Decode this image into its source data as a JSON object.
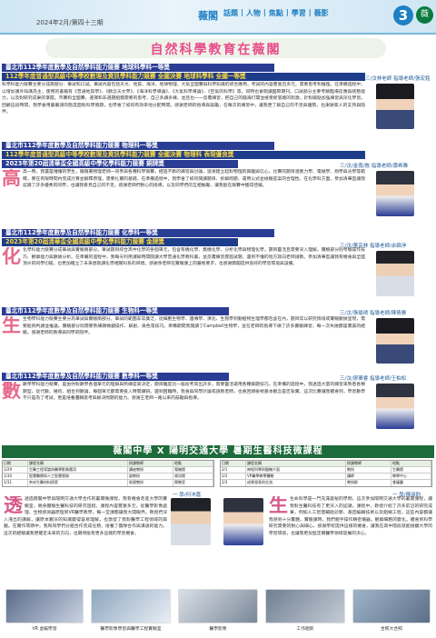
{
  "header": {
    "date": "2024年2月/第四十三期",
    "nav_title": "薇閣",
    "nav": [
      "話題",
      "人物",
      "焦點",
      "學習",
      "薇影"
    ],
    "page_number": "3",
    "logo": "薇"
  },
  "title": "自然科學教育在薇閣",
  "sections": [
    {
      "headline1": "臺北市112學年度數學及自然學科能力競賽 地球科學科一等獎",
      "headline2": "112學年度普通型高級中等學校數理及資訊學科能力競賽 全國決賽 地球科學科 全國一等獎",
      "caption": "三/汶林老師 指導老師/張宏銘",
      "text": "科學科能力競賽主要分成兩部分：筆試和口試。筆試內容包括天文、地質、海洋、地球物理、大氣全國賽與科學知識的綜合應用，考試的內容豐富且多元，需要思考和推理。在準備過程中，以增加課外知識為主，使用的書籍有《普通地質學》、《觀念天文學》、《海洋科學導論》、《大氣科學導論》、《空氣的科學》等，同時也會閱讀國際期刊。口試部分主要考驗臨場反應與統整能力，以及對研究成果的掌握。市賽和全國賽，選擇和非選題組都需要的思考，自己多讀多練，並且也一一反覆練習，把自己的腦海打開並接受新思路的刺激，針對弱點加強練習與深化學習。回顧這段時間，我學會用最嚴謹的態度面對科學問題，也學會了如何有效率地分配時間。感謝老師的指導與鼓勵，在每次的練習中，讓我更了解自己的不足與優勢，也謝謝家人的支持與陪伴。"
    },
    {
      "headline1": "臺北市112學年度數學及自然學科能力競賽 物理科一等獎",
      "headline2": "112學年度普通型高級中等學校數理及資訊學科能力競賽 全國決賽 物理科 表現優良獎",
      "headline3": "2023年第20屆清華盃全國高級中學化學科能力競賽 銅牌獎",
      "caption": "三/汶/金寬/敘 指導老師/蕭希雅",
      "text": "高一時，我還是懵懂的學生，跟隨著物理老師一同參與各種科學競賽。經過不斷的練習與討論，逐漸建立起對物理的興趣與信心。比賽的題目涵蓋力學、電磁學、熱學與光學等範疇，要在有限時間內完成計算並解釋原理，需要扎實的基礎。在準備過程中，我學會了如何閱讀題目、拆解問題、運用公式並檢驗答案的合理性。在化學科方面，參加清華盃讓我認識了許多優秀的同學，也讓我看見自己的不足。感謝老師們耐心的指導，以及同學們的互相勉勵，讓我能在競賽中獲得佳績。"
    },
    {
      "headline1": "臺北市112學年度數學及自然學科能力競賽 化學科一等獎",
      "headline2": "2023年第20屆清華盃全國高級中學化學科能力競賽 金牌獎",
      "caption": "三/汶/董芸林 指導老師/余錦淨",
      "text": "化學科能力競賽分成筆試與實驗兩部分。筆試題目綜合高中化學的各個單元，包含有機化學、無機化學、分析化學與物理化學，題目靈活且需要深入理解。實驗部分則考驗操作技巧、觀察能力與數據分析。在準備的過程中，我每天利用課餘時間閱讀大學普通化學教科書，並反覆練習歷屆試題，遇到不懂的地方就向老師請教。參加清華盃讓我有機會與全國頂尖的同學切磋，也更加確立了未來想就讀化學相關科系的目標。感謝余老師在實驗課上的嚴格要求，也感謝薇閣提供良好的學習環境與設備。"
    },
    {
      "headline1": "臺北市112學年度數學及自然學科能力競賽 生物科一等獎",
      "caption": "三/汶/張瑜琇 指導老師/陳倩雅",
      "text": "生物學科能力競賽主要分為筆試與實驗兩部分。筆試的範圍非常廣泛，從細胞生物學、遺傳學、演化、生態學到動植物生理學都包含在內，題目常以研究情境或實驗數據呈現，需要能夠判讀並推論。實驗部分則需要熟練顯微鏡操作、解剖、染色等技巧。準備期間我閱讀了Campbell生物學，並在老師的指導下做了許多實驗練習，每一次失敗都是寶貴的經驗。感謝老師的教導與同學的陪伴。"
    },
    {
      "headline1": "臺北市112學年度數學及自然學科能力競賽 數學科一等獎",
      "caption": "三/汶/廖軍睿 指導老師/王柏松",
      "text": "數學學科能力競賽，是由你對數學各個單元的理解與熟練度來決定，題目難度比一般段考高出許多，需要靈活運用各種解題技巧。在準備的過程中，我透過大量的練習來熟悉各類題型，從代數、幾何、組合到數論，每個單元都需要投入時間鑽研。遇到困難時，我會與同學討論或請教老師，也會回頭檢視基本觀念是否紮實。這次比賽讓我體會到，學習數學不只是為了考試，更是培養邏輯思考與解決問題的能力。感謝王老師一路以來的鼓勵與指導。"
    }
  ],
  "banner": "薇閣中學 X 陽明交通大學 暑期生醫科技微課程",
  "table_left": [
    [
      "日期",
      "課程名稱",
      "授課教師",
      "地點"
    ],
    [
      "1/29",
      "生醫工程導論與醫學影像應用",
      "講座教授",
      "電機館"
    ],
    [
      "1/30",
      "智慧醫療與人工智慧實務",
      "副教授",
      "資訊館"
    ],
    [
      "1/31",
      "奈米生醫材料探索",
      "助理教授",
      "實驗室"
    ]
  ],
  "table_right": [
    [
      "日期",
      "課程名稱",
      "授課教師",
      "地點"
    ],
    [
      "2/1",
      "神經科學與腦機介面",
      "教授",
      "生醫館"
    ],
    [
      "2/2",
      "VR醫學教學體驗",
      "講師",
      "教學中心"
    ],
    [
      "2/3",
      "成果發表與交流",
      "教授群",
      "會議廳"
    ]
  ],
  "bottom_left": {
    "caption": "一 學/何沛嘉",
    "text": "透過薇閣中學與陽明交通大學合作的暑期微課程，我有機會走進大學的實驗室，親身體驗生醫科技的研究過程。課程內容豐富多元，從醫學影像處理、生物感測器原理到VR醫學教學，每一堂課都讓我大開眼界。教授們深入淺出的講解，讓原本艱深的知識變得容易理解，也激發了我對醫學工程領域的興趣。在實作環節中，我和同學們分組合作完成任務，培養了團隊合作與溝通的能力。這次的經驗讓我更確定未來的方向，也期待能有更多這樣的學習機會。"
  },
  "bottom_right": {
    "caption": "一 學/陳淑鈞",
    "text": "生命科學是一門充滿奧秘的學問，這次參加陽明交通大學的暑期課程，讓我對生醫科技有了更深入的認識。課程中，教授介紹了許多前沿的研究成果，例如人工智慧輔助診斷、基因編輯技術以及組織工程，這些內容都讓我感到十分驚艷。實驗課時，我們親手操作精密儀器，觀察細胞的變化，體會到科學研究需要的耐心與細心。感謝學校提供這樣的機會，讓我在高中階段就能接觸大學的學習環境，也讓我更加堅定朝醫學領域發展的決心。"
  },
  "pictures": [
    "VR 虛擬學習",
    "醫學影像學習與醫學工程實驗室",
    "醫學影像",
    "工作組影",
    "合照大合照"
  ]
}
